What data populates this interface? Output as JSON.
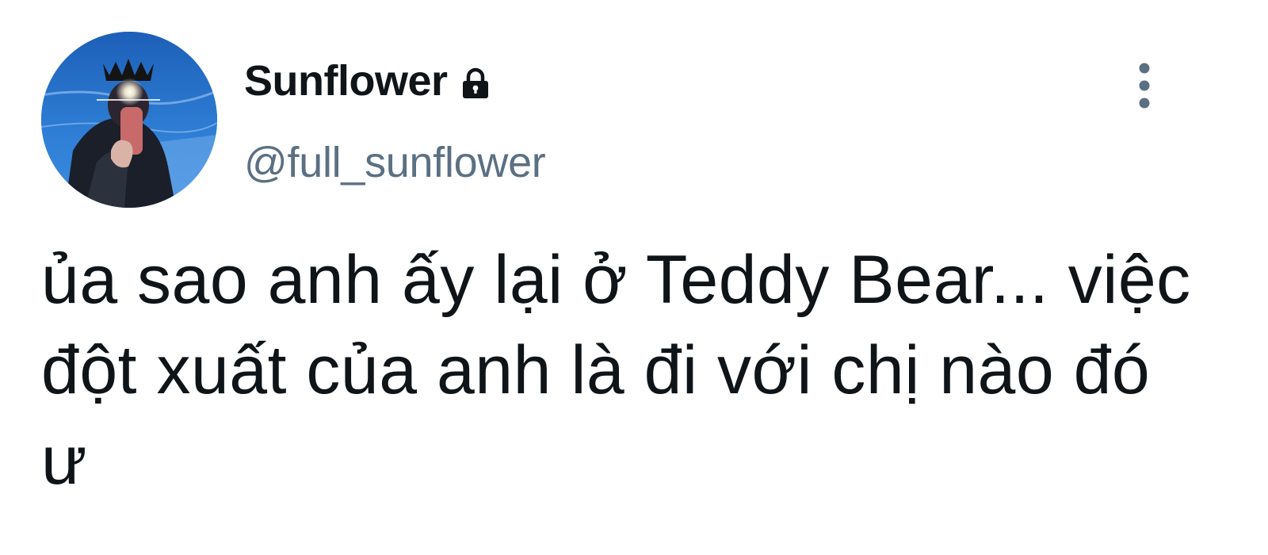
{
  "tweet": {
    "author": {
      "display_name": "Sunflower",
      "handle": "@full_sunflower",
      "avatar_icon": "profile-photo",
      "protected_icon": "lock-icon"
    },
    "menu_icon": "more-vertical-icon",
    "text": "ủa sao anh ấy lại ở Teddy Bear... việc đột xuất của anh là đi với chị nào đó ư"
  },
  "colors": {
    "text_primary": "#0f1419",
    "text_secondary": "#5b7083",
    "background": "#ffffff"
  }
}
